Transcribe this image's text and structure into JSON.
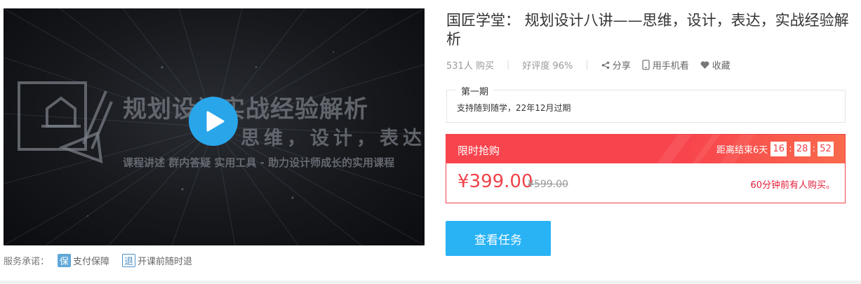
{
  "video": {
    "cover_title": "规划设计实战经验解析",
    "cover_subtitle": "思维，设计，表达",
    "cover_desc": "课程讲述 群内答疑  实用工具 - 助力设计师成长的实用课程",
    "play_icon": "play-icon"
  },
  "promises": {
    "label": "服务承诺：",
    "items": [
      {
        "icon_text": "保",
        "label": "支付保障",
        "icon": "shield-icon"
      },
      {
        "icon_text": "退",
        "label": "开课前随时退",
        "icon": "refund-icon"
      }
    ]
  },
  "course": {
    "title": "国匠学堂： 规划设计八讲——思维，设计，表达，实战经验解析",
    "buyers": "531人 购买",
    "rating": "好评度 96%",
    "share": "分享",
    "mobile": "用手机看",
    "favorite": "收藏"
  },
  "period": {
    "legend": "第一期",
    "desc": "支持随到随学，22年12月过期"
  },
  "flash_sale": {
    "label": "限时抢购",
    "countdown_text": "距离结束6天",
    "hours": "16",
    "minutes": "28",
    "seconds": "52",
    "price": "¥399.00",
    "original_price": "¥599.00",
    "recent": "60分钟前有人购买。"
  },
  "actions": {
    "view_task": "查看任务"
  },
  "colors": {
    "accent_red": "#f0434a",
    "button_blue": "#29b3f5",
    "play_blue": "#29a5ea"
  }
}
